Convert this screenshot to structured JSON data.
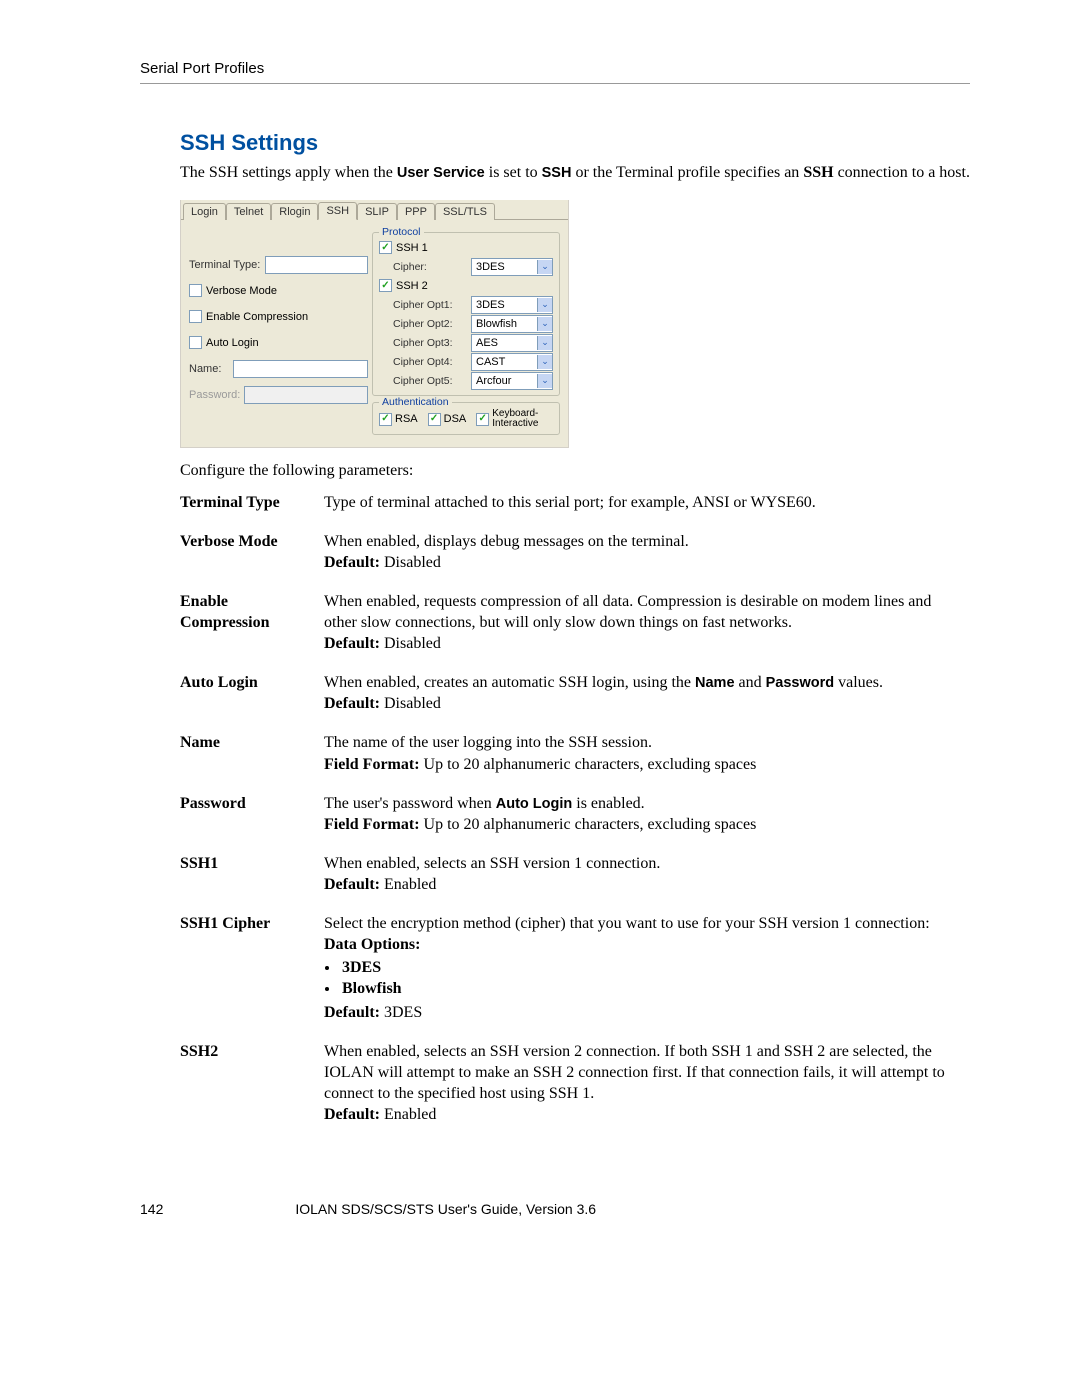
{
  "header": {
    "section": "Serial Port Profiles"
  },
  "title": "SSH Settings",
  "intro": {
    "pre": "The SSH settings apply when the ",
    "b1": "User Service",
    "mid": " is set to ",
    "b2": "SSH",
    "post1": " or the Terminal profile specifies an ",
    "b3": "SSH",
    "post2": " connection to a host."
  },
  "ui": {
    "tabs": [
      "Login",
      "Telnet",
      "Rlogin",
      "SSH",
      "SLIP",
      "PPP",
      "SSL/TLS"
    ],
    "active_tab": "SSH",
    "left": {
      "terminal_type_label": "Terminal Type:",
      "verbose_label": "Verbose Mode",
      "enable_comp_label": "Enable Compression",
      "auto_login_label": "Auto Login",
      "name_label": "Name:",
      "password_label": "Password:"
    },
    "protocol": {
      "group": "Protocol",
      "ssh1": "SSH 1",
      "ssh1_cipher_label": "Cipher:",
      "ssh1_cipher_value": "3DES",
      "ssh2": "SSH 2",
      "rows": [
        {
          "label": "Cipher Opt1:",
          "value": "3DES"
        },
        {
          "label": "Cipher Opt2:",
          "value": "Blowfish"
        },
        {
          "label": "Cipher Opt3:",
          "value": "AES"
        },
        {
          "label": "Cipher Opt4:",
          "value": "CAST"
        },
        {
          "label": "Cipher Opt5:",
          "value": "Arcfour"
        }
      ]
    },
    "auth": {
      "group": "Authentication",
      "rsa": "RSA",
      "dsa": "DSA",
      "kb": "Keyboard-Interactive"
    }
  },
  "params_lead": "Configure the following parameters:",
  "params": [
    {
      "name": "Terminal Type",
      "desc": "Type of terminal attached to this serial port; for example, ANSI or WYSE60."
    },
    {
      "name": "Verbose Mode",
      "desc": "When enabled, displays debug messages on the terminal.",
      "default": "Disabled"
    },
    {
      "name": "Enable Compression",
      "desc": "When enabled, requests compression of all data. Compression is desirable on modem lines and other slow connections, but will only slow down things on fast networks.",
      "default": "Disabled"
    },
    {
      "name": "Auto Login",
      "desc_pre": "When enabled, creates an automatic SSH login, using the ",
      "b1": "Name",
      "mid": " and ",
      "b2": "Password",
      "desc_post": " values.",
      "default": "Disabled"
    },
    {
      "name": "Name",
      "desc": "The name of the user logging into the SSH session.",
      "ff": "Up to 20 alphanumeric characters, excluding spaces"
    },
    {
      "name": "Password",
      "desc_pre": "The user's password when ",
      "b1": "Auto Login",
      "desc_post": " is enabled.",
      "ff": "Up to 20 alphanumeric characters, excluding spaces"
    },
    {
      "name": "SSH1",
      "desc": "When enabled, selects an SSH version 1 connection.",
      "default": "Enabled"
    },
    {
      "name": "SSH1 Cipher",
      "desc": "Select the encryption method (cipher) that you want to use for your SSH version 1 connection:",
      "data_options_label": "Data Options:",
      "options": [
        "3DES",
        "Blowfish"
      ],
      "default": "3DES"
    },
    {
      "name": "SSH2",
      "desc": "When enabled, selects an SSH version 2 connection. If both SSH 1 and SSH 2 are selected, the IOLAN will attempt to make an SSH 2 connection first. If that connection fails, it will attempt to connect to the specified host using SSH 1.",
      "default": "Enabled"
    }
  ],
  "footer": {
    "page": "142",
    "book": "IOLAN SDS/SCS/STS User's Guide, Version 3.6"
  },
  "literals": {
    "check": "✓",
    "chev": "⌄",
    "default_label": "Default:",
    "ff_label": "Field Format:"
  }
}
